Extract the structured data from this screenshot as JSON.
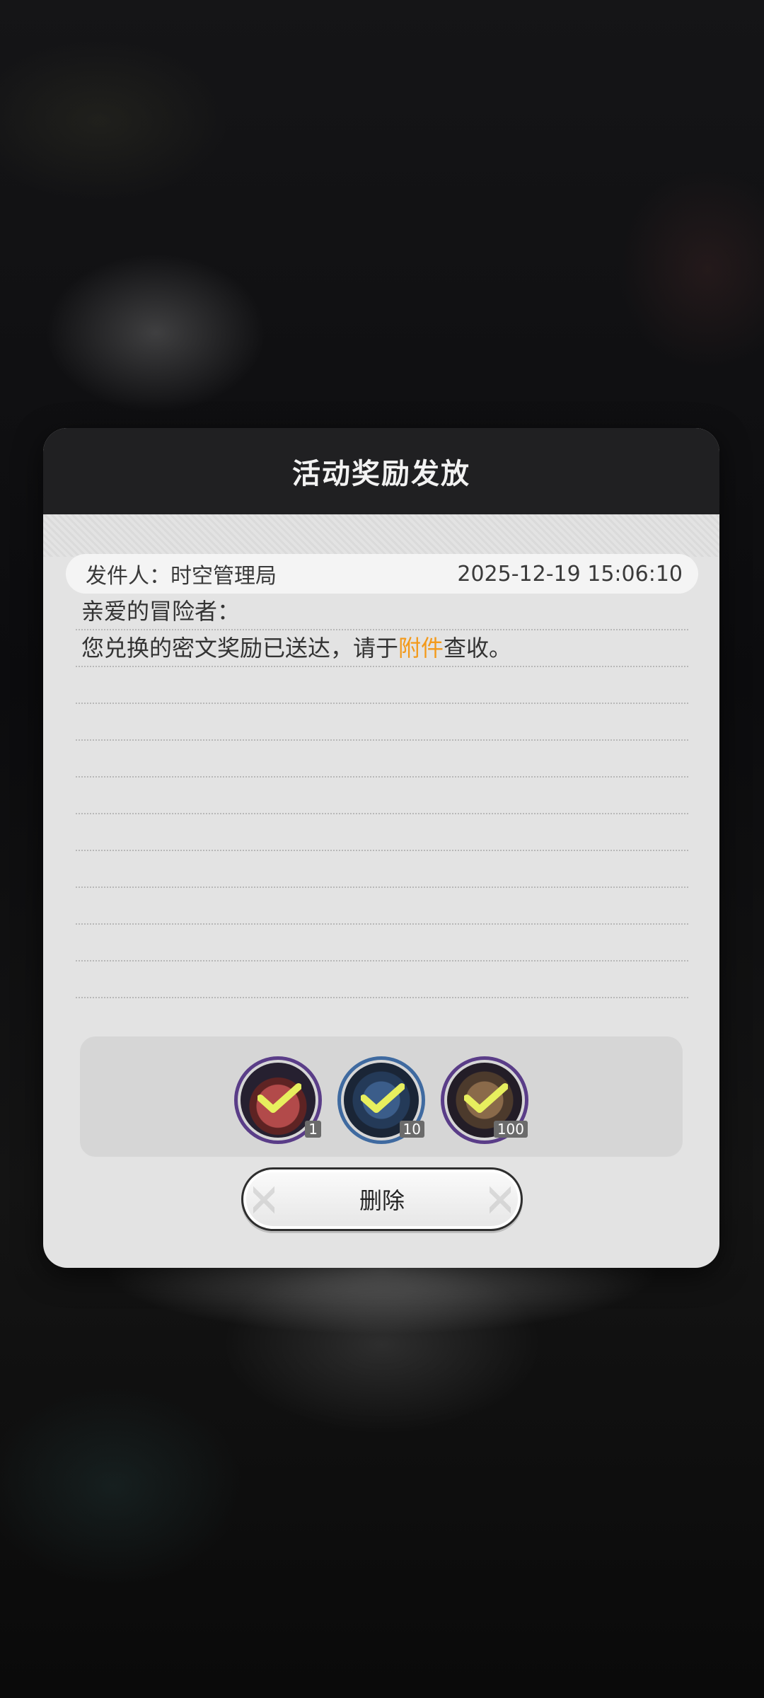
{
  "dialog": {
    "title": "活动奖励发放",
    "sender_label": "发件人：",
    "sender_name": "时空管理局",
    "timestamp": "2025-12-19 15:06:10",
    "greeting": "亲爱的冒险者：",
    "body_prefix": "您兑换的密文奖励已送达，请于",
    "body_link": "附件",
    "body_suffix": "查收。",
    "delete_label": "删除"
  },
  "rewards": [
    {
      "icon": "apple-item-icon",
      "quantity": "1",
      "border": "#5a3d88"
    },
    {
      "icon": "tome-item-icon",
      "quantity": "10",
      "border": "#3f6aa0"
    },
    {
      "icon": "crystal-item-icon",
      "quantity": "100",
      "border": "#5a3d88"
    }
  ],
  "colors": {
    "header_bg": "#202022",
    "panel_bg": "#e3e3e3",
    "link": "#f39a1b",
    "check": "#e7ef5e"
  }
}
